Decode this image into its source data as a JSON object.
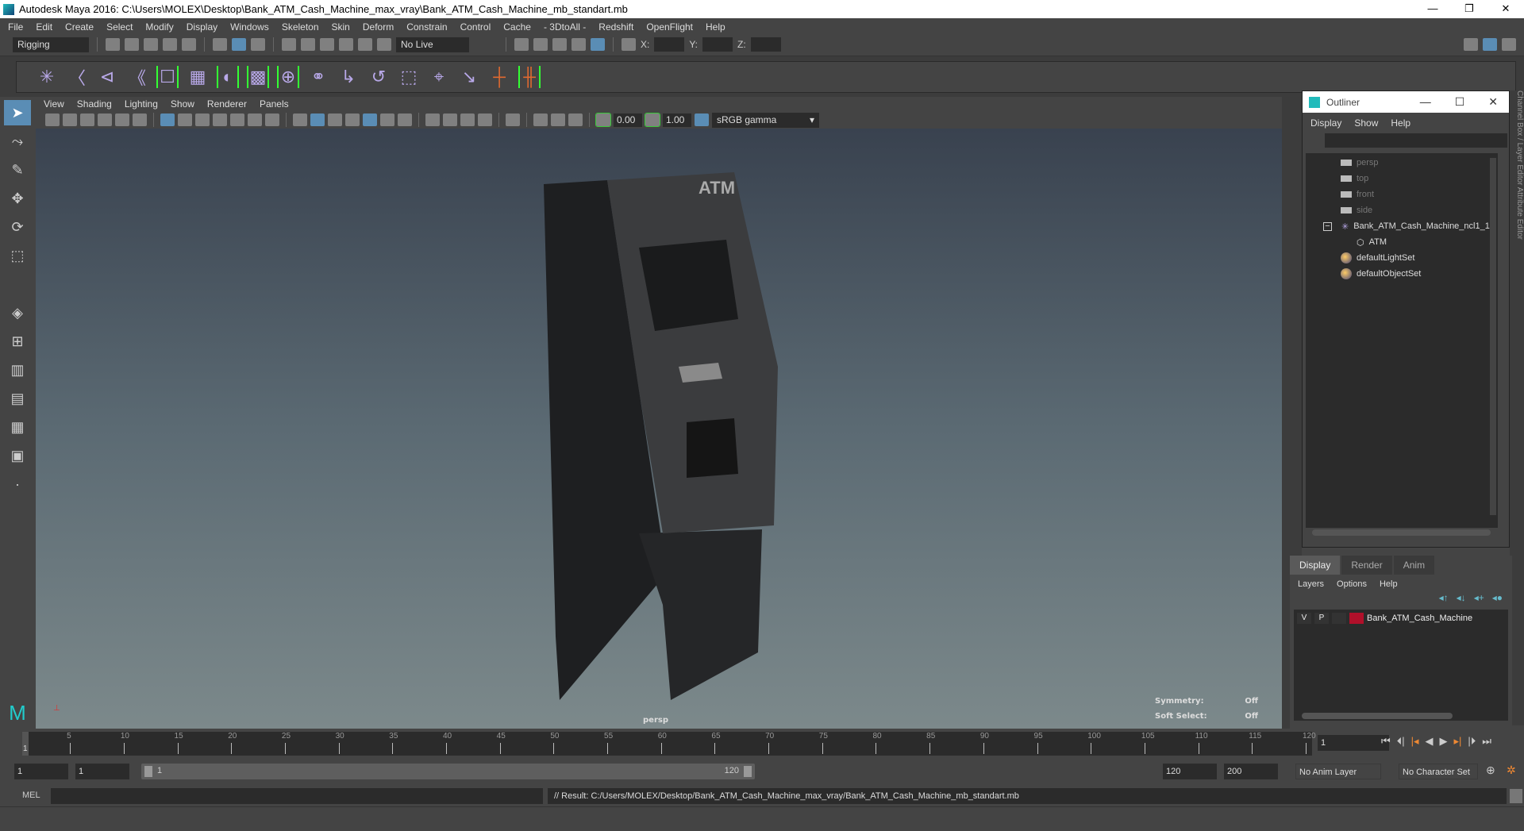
{
  "window": {
    "title": "Autodesk Maya 2016: C:\\Users\\MOLEX\\Desktop\\Bank_ATM_Cash_Machine_max_vray\\Bank_ATM_Cash_Machine_mb_standart.mb",
    "minimize": "—",
    "maximize": "❐",
    "close": "✕"
  },
  "menubar": [
    "File",
    "Edit",
    "Create",
    "Select",
    "Modify",
    "Display",
    "Windows",
    "Skeleton",
    "Skin",
    "Deform",
    "Constrain",
    "Control",
    "Cache",
    "- 3DtoAll -",
    "Redshift",
    "OpenFlight",
    "Help"
  ],
  "shelf": {
    "menu_set": "Rigging",
    "live_surface": "No Live Surface",
    "x_label": "X:",
    "y_label": "Y:",
    "z_label": "Z:"
  },
  "panel_menu": [
    "View",
    "Shading",
    "Lighting",
    "Show",
    "Renderer",
    "Panels"
  ],
  "viewport": {
    "exposure": "0.00",
    "gamma": "1.00",
    "color_space": "sRGB gamma",
    "camera": "persp",
    "model_text": "ATM",
    "hud": {
      "symmetry_label": "Symmetry:",
      "symmetry_value": "Off",
      "soft_select_label": "Soft Select:",
      "soft_select_value": "Off"
    }
  },
  "outliner": {
    "title": "Outliner",
    "menu": [
      "Display",
      "Show",
      "Help"
    ],
    "items": [
      {
        "label": "persp",
        "icon": "camera-icon",
        "dim": true
      },
      {
        "label": "top",
        "icon": "camera-icon",
        "dim": true
      },
      {
        "label": "front",
        "icon": "camera-icon",
        "dim": true
      },
      {
        "label": "side",
        "icon": "camera-icon",
        "dim": true
      },
      {
        "label": "Bank_ATM_Cash_Machine_ncl1_1",
        "icon": "joint-icon",
        "expanded": true
      },
      {
        "label": "ATM",
        "icon": "mesh-icon",
        "child": true
      },
      {
        "label": "defaultLightSet",
        "icon": "set-icon"
      },
      {
        "label": "defaultObjectSet",
        "icon": "set-icon"
      }
    ]
  },
  "channel_strip": "Channel Box / Layer Editor   Attribute Editor",
  "layer_editor": {
    "tabs": [
      "Display",
      "Render",
      "Anim"
    ],
    "menu": [
      "Layers",
      "Options",
      "Help"
    ],
    "layers": [
      {
        "v": "V",
        "p": "P",
        "color": "#b0102a",
        "name": "Bank_ATM_Cash_Machine"
      }
    ]
  },
  "timeline": {
    "ticks": [
      "5",
      "10",
      "15",
      "20",
      "25",
      "30",
      "35",
      "40",
      "45",
      "50",
      "55",
      "60",
      "65",
      "70",
      "75",
      "80",
      "85",
      "90",
      "95",
      "100",
      "105",
      "110",
      "115",
      "120"
    ],
    "current": "1",
    "current_frame_field": "1"
  },
  "range": {
    "start": "1",
    "anim_start": "1",
    "slider_start": "1",
    "slider_end": "120",
    "end": "120",
    "anim_end": "200",
    "anim_layer": "No Anim Layer",
    "character_set": "No Character Set"
  },
  "command": {
    "lang": "MEL",
    "result": "// Result: C:/Users/MOLEX/Desktop/Bank_ATM_Cash_Machine_max_vray/Bank_ATM_Cash_Machine_mb_standart.mb"
  }
}
